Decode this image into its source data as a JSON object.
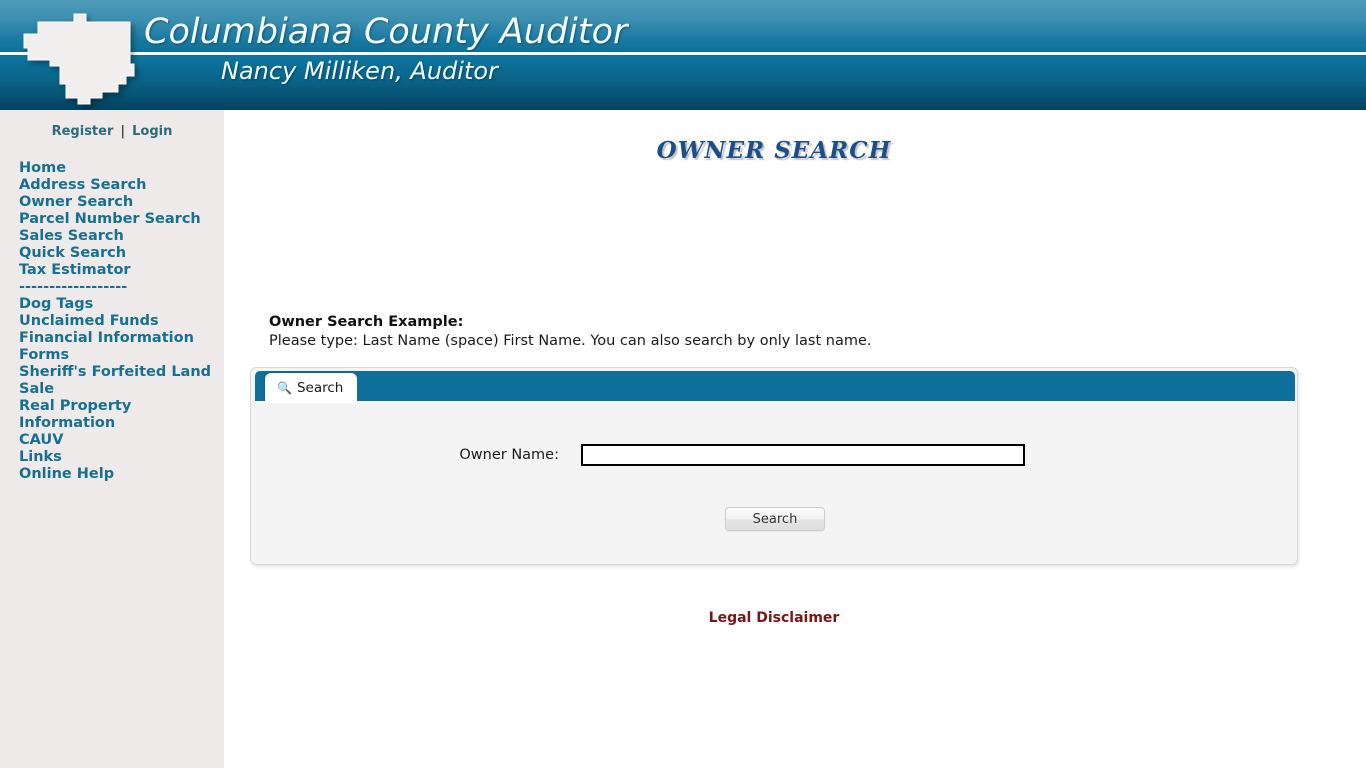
{
  "header": {
    "title": "Columbiana County Auditor",
    "subtitle": "Nancy Milliken, Auditor",
    "logo_icon": "county-map-outline-icon",
    "band_top_color": "#3e90b0",
    "band_bottom_color": "#0a6489"
  },
  "sidebar": {
    "register_label": "Register",
    "separator": "|",
    "login_label": "Login",
    "divider": "------------------",
    "items": [
      {
        "label": "Home"
      },
      {
        "label": "Address Search"
      },
      {
        "label": "Owner Search"
      },
      {
        "label": "Parcel Number Search"
      },
      {
        "label": "Sales Search"
      },
      {
        "label": "Quick Search"
      },
      {
        "label": "Tax Estimator"
      }
    ],
    "items_secondary": [
      {
        "label": "Dog Tags"
      },
      {
        "label": "Unclaimed Funds"
      },
      {
        "label": "Financial Information"
      },
      {
        "label": "Forms"
      },
      {
        "label": "Sheriff's Forfeited Land Sale"
      },
      {
        "label": "Real Property Information"
      },
      {
        "label": "CAUV"
      },
      {
        "label": "Links"
      },
      {
        "label": "Online Help"
      }
    ],
    "link_color": "#17708f",
    "background_color": "#eeeaea"
  },
  "main": {
    "page_title": "OWNER SEARCH",
    "example_heading": "Owner Search Example:",
    "example_text": "Please type: Last Name (space) First Name. You can also search by only last name.",
    "panel": {
      "tab_label": "Search",
      "tab_icon": "magnifier-icon",
      "tabbar_color": "#0e6f9b",
      "owner_name_label": "Owner Name:",
      "owner_name_value": "",
      "owner_name_placeholder": "",
      "search_button_label": "Search"
    },
    "legal_disclaimer": "Legal Disclaimer",
    "legal_color": "#7a1616"
  }
}
